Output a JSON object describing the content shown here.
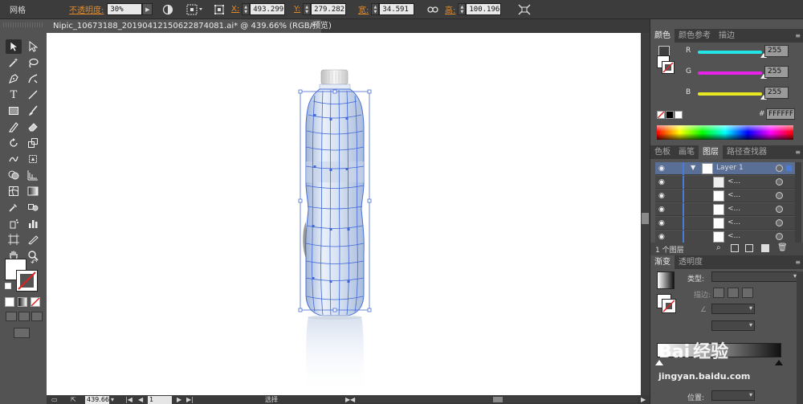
{
  "control_bar": {
    "panel_label": "网格",
    "opacity_label": "不透明度:",
    "opacity_value": "30%",
    "x_label": "X:",
    "x_value": "493.299 p",
    "y_label": "Y:",
    "y_value": "279.282 p",
    "w_label": "宽:",
    "w_value": "34.591 px",
    "h_label": "高:",
    "h_value": "100.196 p"
  },
  "document": {
    "tab_title": "Nipic_10673188_20190412150622874081.ai* @ 439.66% (RGB/预览)",
    "close_glyph": "×"
  },
  "status_bar": {
    "zoom": "439.66",
    "artboard": "1",
    "tool_label": "选择"
  },
  "color_panel": {
    "tabs": [
      "颜色",
      "颜色参考",
      "描边"
    ],
    "channels": [
      {
        "label": "R",
        "value": "255",
        "color": "#22e6e6"
      },
      {
        "label": "G",
        "value": "255",
        "color": "#e822e8"
      },
      {
        "label": "B",
        "value": "255",
        "color": "#e8e822"
      }
    ],
    "hex_prefix": "#",
    "hex_value": "FFFFFF"
  },
  "layers_panel": {
    "tabs": [
      "色板",
      "画笔",
      "图层",
      "路径查找器"
    ],
    "layer_name": "Layer 1",
    "sublayers": [
      "<...",
      "<...",
      "<...",
      "<...",
      "<..."
    ],
    "footer_count": "1 个图层"
  },
  "gradient_panel": {
    "tabs": [
      "渐变",
      "透明度"
    ],
    "type_label": "类型:",
    "stroke_label": "描边:",
    "position_label": "位置:"
  },
  "watermark": {
    "brand": "Bai",
    "text": "经验",
    "sub": "jingyan.baidu.com"
  },
  "colors": {
    "accent_blue": "#4a7bd8",
    "label_orange": "#e08a2a",
    "panel_bg": "#535353",
    "dark_bg": "#3a3a3a"
  }
}
